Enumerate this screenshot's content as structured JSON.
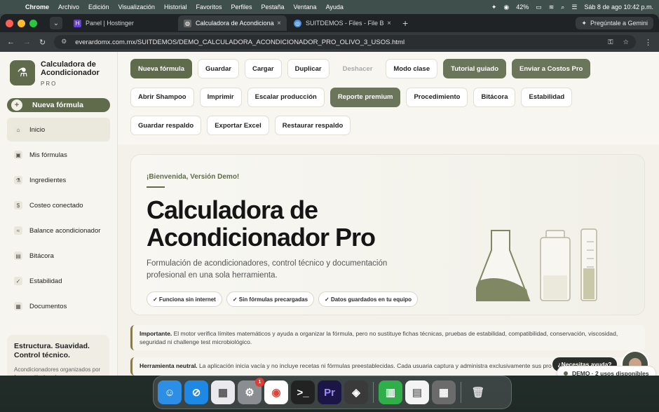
{
  "menubar": {
    "app_name": "Chrome",
    "menus": [
      "Archivo",
      "Edición",
      "Visualización",
      "Historial",
      "Favoritos",
      "Perfiles",
      "Pestaña",
      "Ventana",
      "Ayuda"
    ],
    "battery": "42%",
    "datetime": "Sáb 8 de ago  10:42 p.m."
  },
  "browser": {
    "tabs": [
      {
        "title": "Panel | Hostinger",
        "active": false
      },
      {
        "title": "Calculadora de Acondicionador",
        "active": true
      },
      {
        "title": "SUITDEMOS - Files - File Bro",
        "active": false
      }
    ],
    "gemini_label": "Pregúntale a Gemini",
    "url": "everardomx.com.mx/SUITDEMOS/DEMO_CALCULADORA_ACONDICIONADOR_PRO_OLIVO_3_USOS.html"
  },
  "sidebar": {
    "brand_title": "Calculadora de Acondicionador",
    "brand_sub": "PRO",
    "new_formula": "Nueva fórmula",
    "items": [
      {
        "label": "Inicio",
        "icon": "home-icon",
        "active": true
      },
      {
        "label": "Mis fórmulas",
        "icon": "formulas-icon",
        "active": false
      },
      {
        "label": "Ingredientes",
        "icon": "ingredients-icon",
        "active": false
      },
      {
        "label": "Costeo conectado",
        "icon": "dollar-icon",
        "active": false
      },
      {
        "label": "Balance acondicionador",
        "icon": "balance-icon",
        "active": false
      },
      {
        "label": "Bitácora",
        "icon": "log-icon",
        "active": false
      },
      {
        "label": "Estabilidad",
        "icon": "check-icon",
        "active": false
      },
      {
        "label": "Documentos",
        "icon": "documents-icon",
        "active": false
      }
    ],
    "card_title": "Estructura. Suavidad. Control técnico.",
    "card_text": "Acondicionadores organizados por fases, cálculos claros y"
  },
  "toolbar": {
    "buttons": [
      {
        "label": "Nueva fórmula",
        "style": "dark"
      },
      {
        "label": "Guardar",
        "style": "light"
      },
      {
        "label": "Cargar",
        "style": "light"
      },
      {
        "label": "Duplicar",
        "style": "light"
      },
      {
        "label": "Deshacer",
        "style": "disabled"
      },
      {
        "label": "Modo clase",
        "style": "light"
      },
      {
        "label": "Tutorial guiado",
        "style": "mid"
      },
      {
        "label": "Enviar a Costos Pro",
        "style": "mid"
      },
      {
        "label": "Abrir Shampoo",
        "style": "light"
      },
      {
        "label": "Imprimir",
        "style": "light"
      },
      {
        "label": "Escalar producción",
        "style": "light"
      },
      {
        "label": "Reporte premium",
        "style": "mid"
      },
      {
        "label": "Procedimiento",
        "style": "light"
      },
      {
        "label": "Bitácora",
        "style": "light"
      },
      {
        "label": "Estabilidad",
        "style": "light"
      },
      {
        "label": "Guardar respaldo",
        "style": "light"
      },
      {
        "label": "Exportar Excel",
        "style": "light"
      },
      {
        "label": "Restaurar respaldo",
        "style": "light"
      }
    ]
  },
  "hero": {
    "kicker": "¡Bienvenida, Versión Demo!",
    "title_line1": "Calculadora de",
    "title_line2": "Acondicionador Pro",
    "subtitle": "Formulación de acondicionadores, control técnico y documentación profesional en una sola herramienta.",
    "pills": [
      "✓ Funciona sin internet",
      "✓ Sin fórmulas precargadas",
      "✓ Datos guardados en tu equipo"
    ]
  },
  "notices": [
    {
      "bold": "Importante.",
      "text": " El motor verifica límites matemáticos y ayuda a organizar la fórmula, pero no sustituye fichas técnicas, pruebas de estabilidad, compatibilidad, conservación, viscosidad, seguridad ni challenge test microbiológico."
    },
    {
      "bold": "Herramienta neutral.",
      "text": " La aplicación inicia vacía y no incluye recetas ni fórmulas preestablecidas. Cada usuaria captura y administra exclusivamente sus pro"
    }
  ],
  "chat": {
    "bubble": "¿Necesitas ayuda?"
  },
  "demo_badge": "DEMO · 2 usos disponibles",
  "dock": {
    "badge_count": "1"
  },
  "colors": {
    "accent": "#5f6b4b",
    "accent_mid": "#6b7559",
    "bg": "#f3f1ea"
  }
}
